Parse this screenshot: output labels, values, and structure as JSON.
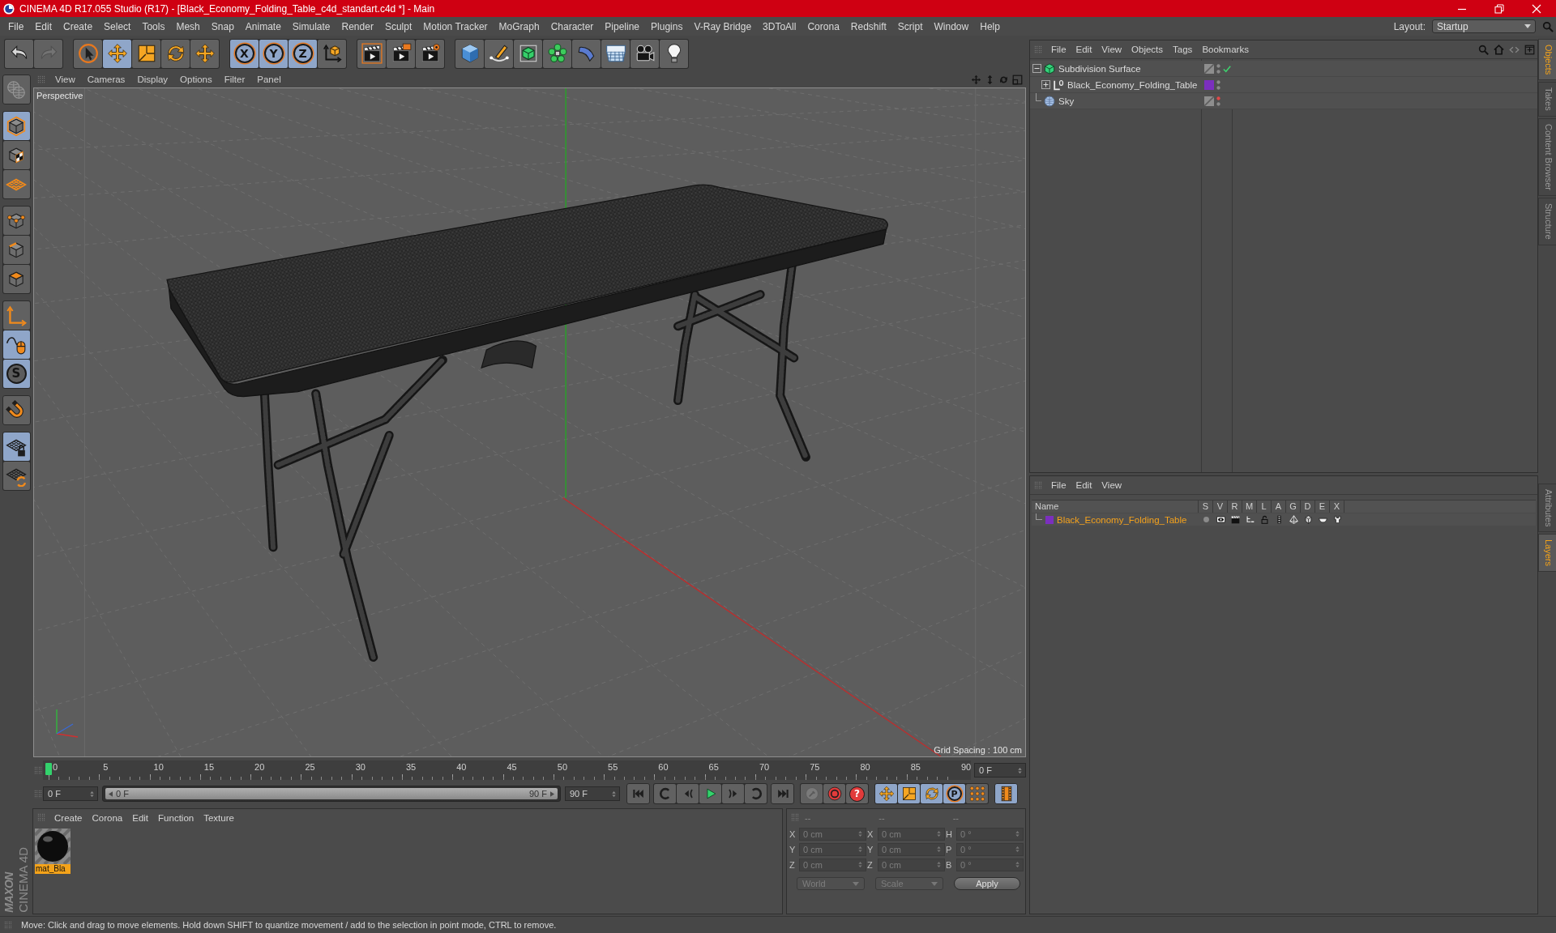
{
  "window": {
    "title": "CINEMA 4D R17.055 Studio (R17) - [Black_Economy_Folding_Table_c4d_standart.c4d *] - Main"
  },
  "menu_bar": {
    "items": [
      "File",
      "Edit",
      "Create",
      "Select",
      "Tools",
      "Mesh",
      "Snap",
      "Animate",
      "Simulate",
      "Render",
      "Sculpt",
      "Motion Tracker",
      "MoGraph",
      "Character",
      "Pipeline",
      "Plugins",
      "V-Ray Bridge",
      "3DToAll",
      "Corona",
      "Redshift",
      "Script",
      "Window",
      "Help"
    ],
    "layout_label": "Layout:",
    "layout_value": "Startup"
  },
  "toolbar": {
    "groups": [
      {
        "buttons": [
          {
            "kind": "undo",
            "active": false
          },
          {
            "kind": "redo",
            "active": false
          }
        ]
      },
      {
        "buttons": [
          {
            "kind": "select",
            "active": false
          },
          {
            "kind": "move",
            "active": true
          },
          {
            "kind": "scale",
            "active": false
          },
          {
            "kind": "rotate",
            "active": false
          },
          {
            "kind": "transform",
            "active": false
          }
        ]
      },
      {
        "buttons": [
          {
            "kind": "axis",
            "label": "X",
            "active": true
          },
          {
            "kind": "axis",
            "label": "Y",
            "active": true
          },
          {
            "kind": "axis",
            "label": "Z",
            "active": true
          },
          {
            "kind": "coords",
            "active": false
          }
        ]
      },
      {
        "buttons": [
          {
            "kind": "renderview",
            "active": false
          },
          {
            "kind": "renderpicture",
            "active": false
          },
          {
            "kind": "rendersettings",
            "active": false
          }
        ]
      },
      {
        "buttons": [
          {
            "kind": "cube",
            "active": false
          },
          {
            "kind": "pen",
            "active": false
          },
          {
            "kind": "subdivision",
            "active": false
          },
          {
            "kind": "cloner",
            "active": false
          },
          {
            "kind": "bend",
            "active": false
          },
          {
            "kind": "floor",
            "active": false
          },
          {
            "kind": "camera",
            "active": false
          },
          {
            "kind": "light",
            "active": false
          }
        ]
      }
    ]
  },
  "mode_toolbar": {
    "groups": [
      {
        "buttons": [
          {
            "kind": "convert",
            "active": false
          }
        ]
      },
      {
        "buttons": [
          {
            "kind": "model",
            "active": true
          },
          {
            "kind": "texture",
            "active": false
          },
          {
            "kind": "workplane",
            "active": false
          }
        ]
      },
      {
        "buttons": [
          {
            "kind": "points",
            "active": false
          },
          {
            "kind": "edges",
            "active": false
          },
          {
            "kind": "polygons",
            "active": false
          }
        ]
      },
      {
        "buttons": [
          {
            "kind": "axismode",
            "active": false
          },
          {
            "kind": "tweak",
            "active": true
          },
          {
            "kind": "solo",
            "label": "S",
            "active": true
          }
        ]
      },
      {
        "buttons": [
          {
            "kind": "magnet",
            "active": false
          }
        ]
      },
      {
        "buttons": [
          {
            "kind": "planelock",
            "active": true
          },
          {
            "kind": "planesync",
            "active": false
          }
        ]
      }
    ]
  },
  "viewport": {
    "menu": [
      "View",
      "Cameras",
      "Display",
      "Options",
      "Filter",
      "Panel"
    ],
    "camera": "Perspective",
    "grid_spacing": "Grid Spacing : 100 cm"
  },
  "timeline": {
    "ticks": [
      "0",
      "5",
      "10",
      "15",
      "20",
      "25",
      "30",
      "35",
      "40",
      "45",
      "50",
      "55",
      "60",
      "65",
      "70",
      "75",
      "80",
      "85",
      "90"
    ],
    "playhead": {
      "level": 0
    },
    "current_frame": "0 F",
    "start_frame": "0 F",
    "range": {
      "start": "0 F",
      "end": "90 F",
      "level": 1
    },
    "end_frame": "90 F",
    "transport": {
      "groups": [
        {
          "buttons": [
            {
              "kind": "first"
            }
          ]
        },
        {
          "buttons": [
            {
              "kind": "prevkey"
            },
            {
              "kind": "prev"
            },
            {
              "kind": "play"
            },
            {
              "kind": "next"
            },
            {
              "kind": "nextkey"
            }
          ]
        },
        {
          "buttons": [
            {
              "kind": "last"
            }
          ]
        }
      ]
    },
    "record": {
      "buttons": [
        {
          "kind": "keyframe",
          "active": false
        },
        {
          "kind": "autokey",
          "active": false
        },
        {
          "kind": "keyset",
          "label": "?",
          "active": false
        }
      ]
    },
    "key_filters": {
      "groups": [
        {
          "buttons": [
            {
              "kind": "move",
              "active": true
            },
            {
              "kind": "scale",
              "active": true
            },
            {
              "kind": "rotate",
              "active": true
            },
            {
              "kind": "param",
              "label": "P",
              "active": true
            },
            {
              "kind": "pointkey",
              "active": false
            }
          ]
        },
        {
          "buttons": [
            {
              "kind": "timeline",
              "active": true
            }
          ]
        }
      ]
    }
  },
  "materials": {
    "menu": [
      "Create",
      "Corona",
      "Edit",
      "Function",
      "Texture"
    ],
    "items": [
      {
        "name": "mat_Bla",
        "selected": true
      }
    ]
  },
  "coordinates": {
    "headers": [
      "--",
      "--",
      "--"
    ],
    "disabled": true,
    "rows": [
      {
        "position_axis": "X",
        "position": "0 cm",
        "size_axis": "X",
        "size": "0 cm",
        "rotation_axis": "H",
        "rotation": "0 °"
      },
      {
        "position_axis": "Y",
        "position": "0 cm",
        "size_axis": "Y",
        "size": "0 cm",
        "rotation_axis": "P",
        "rotation": "0 °"
      },
      {
        "position_axis": "Z",
        "position": "0 cm",
        "size_axis": "Z",
        "size": "0 cm",
        "rotation_axis": "B",
        "rotation": "0 °"
      }
    ],
    "space": "World",
    "mode": "Scale",
    "apply": "Apply"
  },
  "object_manager": {
    "menu": [
      "File",
      "Edit",
      "View",
      "Objects",
      "Tags",
      "Bookmarks"
    ],
    "objects": [
      {
        "name": "Subdivision Surface",
        "kind": "subdivision",
        "expandable": true,
        "expanded": true,
        "editor_hidden": false,
        "enabled_check": true,
        "children": [
          {
            "name": "Black_Economy_Folding_Table",
            "kind": "null",
            "expandable": true,
            "expanded": false,
            "color": "#7b2fbe",
            "editor_hidden": false,
            "enabled_check": false
          }
        ]
      },
      {
        "name": "Sky",
        "kind": "sky",
        "expandable": false,
        "editor_hidden": true,
        "enabled_check": false
      }
    ]
  },
  "layer_manager": {
    "menu": [
      "File",
      "Edit",
      "View"
    ],
    "columns": [
      "Name",
      "S",
      "V",
      "R",
      "M",
      "L",
      "A",
      "G",
      "D",
      "E",
      "X"
    ],
    "layers": [
      {
        "name": "Black_Economy_Folding_Table",
        "color": "#7b2fbe",
        "selected": true
      }
    ]
  },
  "side_tabs": {
    "top": [
      {
        "label": "Objects",
        "selected": true
      },
      {
        "label": "Takes",
        "selected": false
      },
      {
        "label": "Content Browser",
        "selected": false
      },
      {
        "label": "Structure",
        "selected": false
      }
    ],
    "bottom": [
      {
        "label": "Attributes",
        "selected": false
      },
      {
        "label": "Layers",
        "selected": true
      }
    ]
  },
  "logo": {
    "brand": "MAXON",
    "product": "CINEMA 4D"
  },
  "status_bar": {
    "text": "Move: Click and drag to move elements. Hold down SHIFT to quantize movement / add to the selection in point mode, CTRL to remove."
  }
}
